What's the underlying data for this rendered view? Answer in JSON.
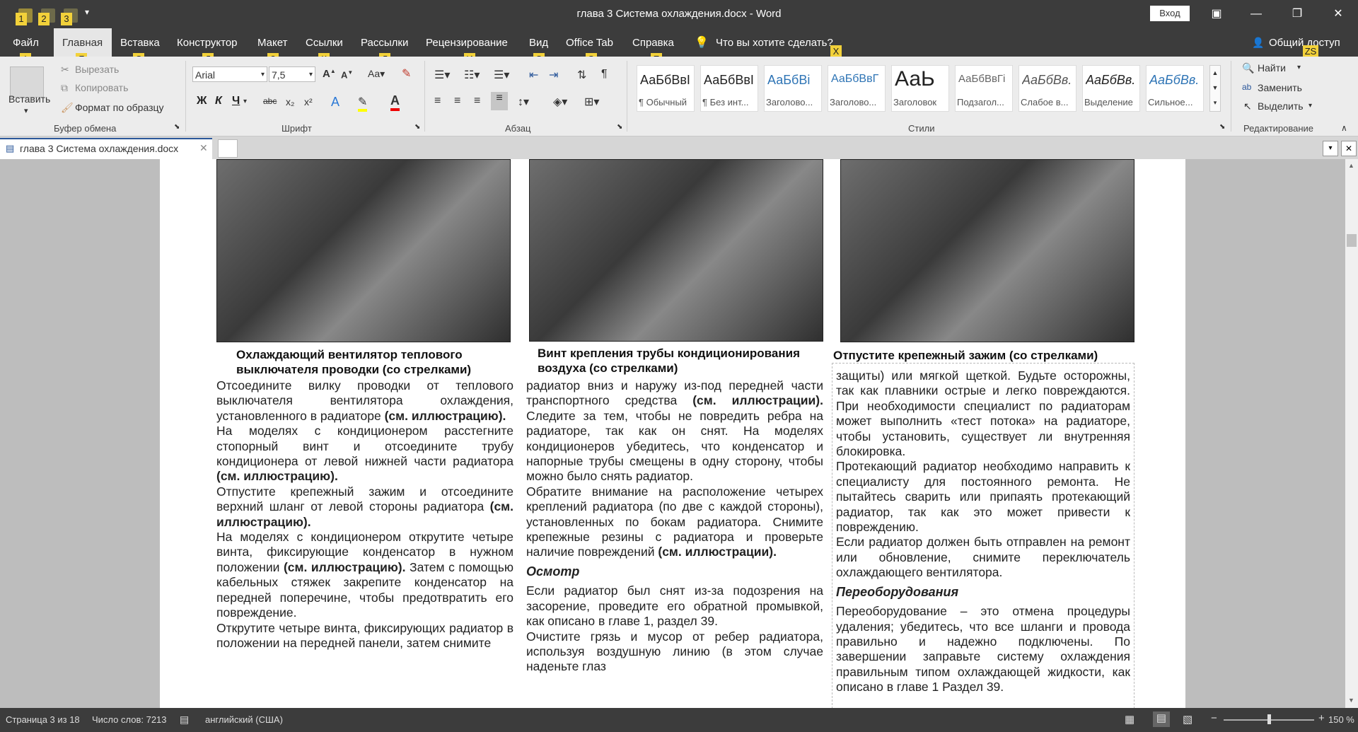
{
  "titlebar": {
    "title": "глава 3 Система охлаждения.docx  -  Word",
    "signin": "Вход",
    "qat_keytips": [
      "1",
      "2",
      "3"
    ]
  },
  "tabs": [
    {
      "label": "Файл",
      "keytip": "Ф"
    },
    {
      "label": "Главная",
      "keytip": "Я"
    },
    {
      "label": "Вставка",
      "keytip": "С"
    },
    {
      "label": "Конструктор",
      "keytip": "Д"
    },
    {
      "label": "Макет",
      "keytip": "З"
    },
    {
      "label": "Ссылки",
      "keytip": "К"
    },
    {
      "label": "Рассылки",
      "keytip": "Л"
    },
    {
      "label": "Рецензирование",
      "keytip": "И"
    },
    {
      "label": "Вид",
      "keytip": "О"
    },
    {
      "label": "Office Tab",
      "keytip": "Э"
    },
    {
      "label": "Справка",
      "keytip": "Е"
    }
  ],
  "tellme": {
    "label": "Что вы хотите сделать?",
    "keytip": "X"
  },
  "share": {
    "label": "Общий доступ",
    "keytip": "ZS"
  },
  "ribbon": {
    "clipboard": {
      "paste": "Вставить",
      "cut": "Вырезать",
      "copy": "Копировать",
      "format_painter": "Формат по образцу",
      "group_label": "Буфер обмена"
    },
    "font": {
      "family": "Arial",
      "size": "7,5",
      "group_label": "Шрифт",
      "bold": "Ж",
      "italic": "К",
      "underline": "Ч",
      "strike": "abc",
      "sub": "x₂",
      "sup": "x²"
    },
    "paragraph": {
      "group_label": "Абзац"
    },
    "styles": {
      "group_label": "Стили",
      "items": [
        {
          "preview": "АаБбВвІ",
          "name": "¶ Обычный"
        },
        {
          "preview": "АаБбВвІ",
          "name": "¶ Без инт..."
        },
        {
          "preview": "АаБбВі",
          "name": "Заголово..."
        },
        {
          "preview": "АаБбВвГ",
          "name": "Заголово..."
        },
        {
          "preview": "АаЬ",
          "name": "Заголовок"
        },
        {
          "preview": "АаБбВвГі",
          "name": "Подзагол..."
        },
        {
          "preview": "АаБбВв.",
          "name": "Слабое в..."
        },
        {
          "preview": "АаБбВв.",
          "name": "Выделение"
        },
        {
          "preview": "АаБбВв.",
          "name": "Сильное..."
        }
      ]
    },
    "editing": {
      "group_label": "Редактирование",
      "find": "Найти",
      "replace": "Заменить",
      "select": "Выделить"
    }
  },
  "doc_tab": {
    "label": "глава 3 Система охлаждения.docx"
  },
  "document": {
    "captions": [
      "Охлаждающий вентилятор теплового выключателя проводки (со стрелками)",
      "Винт крепления трубы кондиционирования воздуха (со стрелками)",
      "Отпустите крепежный зажим (со стрелками)"
    ],
    "col1": [
      {
        "text": "Отсоедините вилку проводки от теплового выключателя вентилятора охлаждения, установленного в радиаторе ",
        "bold": "(см. иллюстрацию)."
      },
      {
        "text": "На моделях с кондиционером расстегните стопорный винт и отсоедините трубу кондиционера от левой нижней части радиатора ",
        "bold": "(см. иллюстрацию)."
      },
      {
        "text": "Отпустите крепежный зажим и отсоедините верхний шланг от левой стороны радиатора ",
        "bold": "(см. иллюстрацию)."
      },
      {
        "text": "На моделях с кондиционером открутите четыре винта, фиксирующие конденсатор в нужном положении ",
        "bold": "(см. иллюстрацию).",
        "tail": " Затем с помощью кабельных стяжек закрепите конденсатор на передней поперечине, чтобы предотвратить его повреждение."
      },
      {
        "text": "Открутите четыре винта, фиксирующих радиатор в положении на передней панели, затем снимите",
        "bold": ""
      }
    ],
    "col2": {
      "p1": {
        "text": "радиатор вниз и наружу из-под передней части транспортного средства ",
        "bold": "(см. иллюстрации).",
        "tail": " Следите за тем, чтобы не повредить ребра на радиаторе, так как он снят. На моделях кондиционеров убедитесь, что конденсатор и напорные трубы смещены в одну сторону, чтобы можно было снять радиатор."
      },
      "p2": {
        "text": "Обратите внимание на расположение четырех креплений радиатора (по две с каждой стороны), установленных по бокам радиатора. Снимите крепежные резины с радиатора и проверьте наличие повреждений ",
        "bold": "(см. иллюстрации)."
      },
      "heading": "Осмотр",
      "p3": "Если радиатор был снят из-за подозрения на засорение, проведите его обратной промывкой, как описано в главе 1, раздел 39.",
      "p4": "Очистите грязь и мусор от ребер радиатора, используя воздушную линию (в этом случае наденьте глаз"
    },
    "col3": {
      "p1": "защиты) или мягкой щеткой. Будьте осторожны, так как плавники острые и легко повреждаются. При необходимости специалист по радиаторам может выполнить «тест потока» на радиаторе, чтобы установить, существует ли внутренняя блокировка.",
      "p2": "Протекающий радиатор необходимо направить к специалисту для постоянного ремонта. Не пытайтесь сварить или припаять протекающий радиатор, так как это может привести к повреждению.",
      "p3": "Если радиатор должен быть отправлен на ремонт или обновление, снимите переключатель охлаждающего вентилятора.",
      "heading": "Переоборудования",
      "p4": "Переоборудование – это отмена процедуры удаления; убедитесь, что все шланги и провода правильно и надежно подключены. По завершении заправьте систему охлаждения правильным типом охлаждающей жидкости, как описано в главе 1 Раздел 39."
    }
  },
  "status": {
    "page": "Страница 3 из 18",
    "words": "Число слов: 7213",
    "language": "английский (США)",
    "zoom": "150 %"
  },
  "colors": {
    "accent": "#2b579a",
    "keytip": "#f2d13a",
    "dark": "#3c3c3c"
  }
}
